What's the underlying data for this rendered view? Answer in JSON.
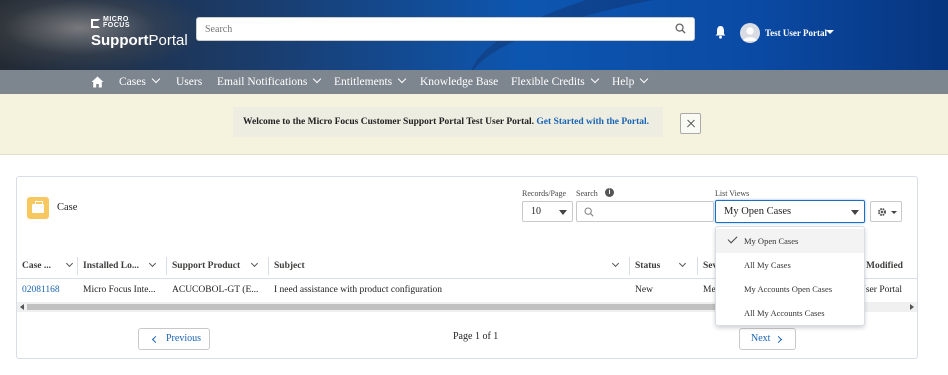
{
  "header": {
    "logo_small_line1": "MICRO",
    "logo_small_line2": "FOCUS",
    "logo_big_bold": "Support",
    "logo_big_rest": "Portal",
    "search_placeholder": "Search",
    "user_name": "Test User Portal"
  },
  "nav": {
    "items": [
      {
        "label": "Cases"
      },
      {
        "label": "Users"
      },
      {
        "label": "Email Notifications"
      },
      {
        "label": "Entitlements"
      },
      {
        "label": "Knowledge Base"
      },
      {
        "label": "Flexible Credits"
      },
      {
        "label": "Help"
      }
    ]
  },
  "welcome": {
    "text": "Welcome to the Micro Focus Customer Support Portal  Test User Portal.",
    "link": "Get Started with the Portal."
  },
  "case_list": {
    "title": "Case",
    "records_label": "Records/Page",
    "records_value": "10",
    "search_label": "Search",
    "list_views_label": "List Views",
    "list_view_selected": "My Open Cases",
    "columns": [
      "Case ...",
      "Installed Lo...",
      "Support Product",
      "Subject",
      "Status",
      "Sev",
      "Modified"
    ],
    "rows": [
      {
        "case": "02081168",
        "installed": "Micro Focus Inte...",
        "product": "ACUCOBOL-GT (E...",
        "subject": "I need assistance with product configuration",
        "status": "New",
        "severity": "Me",
        "modified": "User Portal"
      }
    ],
    "prev_label": "Previous",
    "next_label": "Next",
    "page_info": "Page 1 of 1"
  },
  "list_views_menu": {
    "items": [
      "My Open Cases",
      "All My Cases",
      "My Accounts Open Cases",
      "All My Accounts Cases"
    ]
  },
  "colors": {
    "accent": "#1a64b4",
    "nav_bg": "#7d858f",
    "welcome_bg": "#f5f3dd",
    "case_icon": "#f6c85f"
  }
}
